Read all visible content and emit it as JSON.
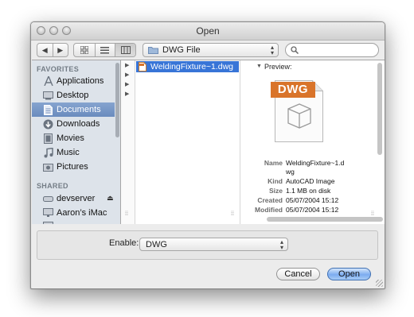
{
  "window": {
    "title": "Open"
  },
  "toolbar": {
    "nav_back": "◀",
    "nav_forward": "▶",
    "location": "DWG File",
    "search_placeholder": ""
  },
  "sidebar": {
    "favorites_header": "FAVORITES",
    "favorites": [
      {
        "label": "Applications",
        "icon": "applications-icon"
      },
      {
        "label": "Desktop",
        "icon": "desktop-icon"
      },
      {
        "label": "Documents",
        "icon": "documents-icon",
        "selected": true
      },
      {
        "label": "Downloads",
        "icon": "downloads-icon"
      },
      {
        "label": "Movies",
        "icon": "movies-icon"
      },
      {
        "label": "Music",
        "icon": "music-icon"
      },
      {
        "label": "Pictures",
        "icon": "pictures-icon"
      }
    ],
    "shared_header": "SHARED",
    "shared": [
      {
        "label": "devserver",
        "icon": "server-icon"
      },
      {
        "label": "Aaron’s iMac",
        "icon": "imac-icon"
      }
    ]
  },
  "browser": {
    "file": {
      "name": "WeldingFixture~1.dwg",
      "icon": "dwg-file-icon"
    }
  },
  "preview": {
    "header": "Preview:",
    "badge": "DWG",
    "rows": [
      {
        "key": "Name",
        "value": "WeldingFixture~1.d"
      },
      {
        "key": "",
        "value": "wg"
      },
      {
        "key": "Kind",
        "value": "AutoCAD Image"
      },
      {
        "key": "Size",
        "value": "1.1 MB on disk"
      },
      {
        "key": "Created",
        "value": "05/07/2004 15:12"
      },
      {
        "key": "Modified",
        "value": "05/07/2004 15:12"
      }
    ]
  },
  "filter": {
    "label": "Enable:",
    "value": "DWG"
  },
  "buttons": {
    "cancel": "Cancel",
    "open": "Open"
  }
}
